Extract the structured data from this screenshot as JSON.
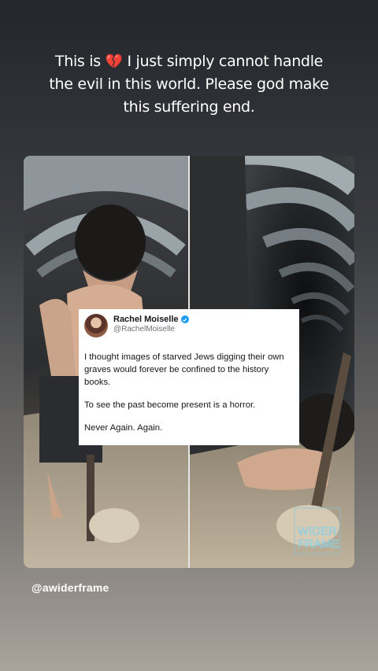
{
  "story": {
    "caption_before": "This is ",
    "caption_emoji": "💔",
    "caption_after": " I just simply cannot handle the evil in this world. Please god make this suffering end.",
    "username": "@awiderframe"
  },
  "tweet": {
    "display_name": "Rachel Moiselle",
    "handle": "@RachelMoiselle",
    "paragraphs": [
      "I thought images of starved Jews digging their own graves would forever be confined to the history books.",
      "To see the past become present is a horror.",
      "Never Again. Again."
    ]
  },
  "watermark": {
    "line1": "WIDER",
    "line2": "FRAME"
  }
}
